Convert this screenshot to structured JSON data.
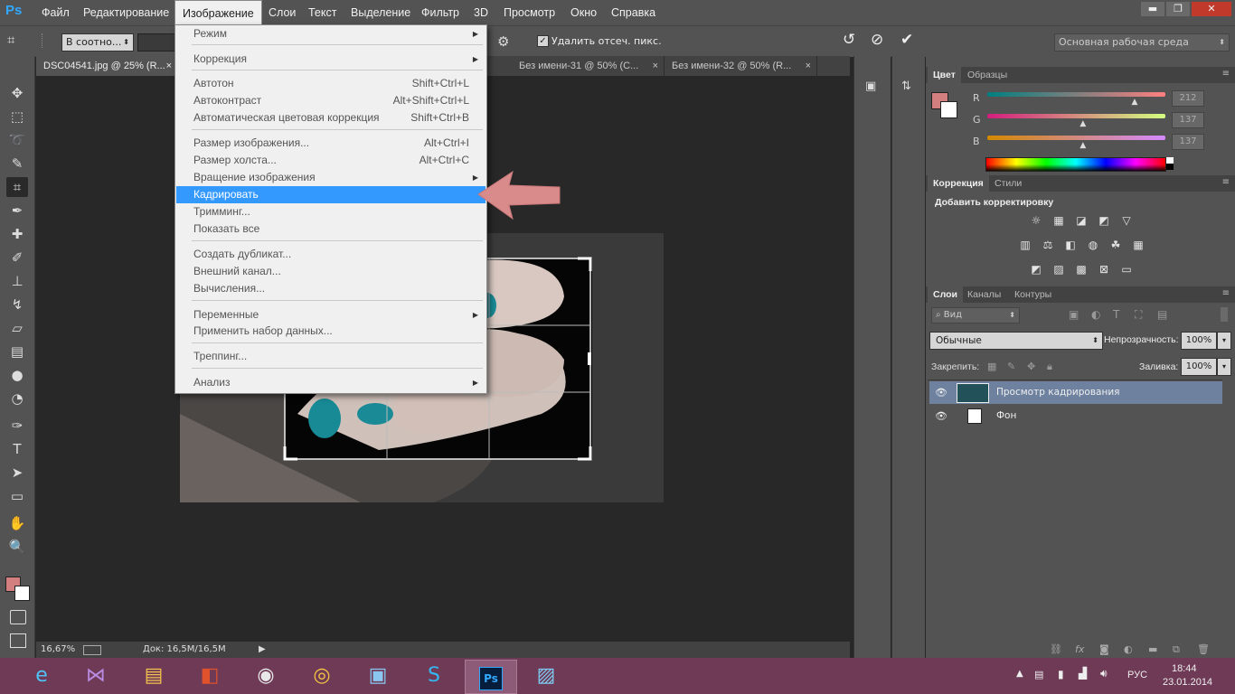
{
  "app": {
    "logo": "Ps"
  },
  "menubar": {
    "items": [
      "Файл",
      "Редактирование",
      "Изображение",
      "Слои",
      "Текст",
      "Выделение",
      "Фильтр",
      "3D",
      "Просмотр",
      "Окно",
      "Справка"
    ],
    "open_item": "Изображение"
  },
  "window_controls": {
    "minimize": "▬",
    "restore": "❐",
    "close": "✕"
  },
  "options_bar": {
    "ratio_select": "В соотно...",
    "delete_cropped_label": "Удалить отсеч. пикс.",
    "delete_cropped_checked": true,
    "workspace": "Основная рабочая среда"
  },
  "doc_tabs": [
    {
      "label": "DSC04541.jpg @ 25% (R...",
      "active": true,
      "close": "×"
    },
    {
      "label": "Без имени-31 @ 50% (C...",
      "active": false,
      "close": "×"
    },
    {
      "label": "Без имени-32 @ 50% (R...",
      "active": false,
      "close": "×"
    }
  ],
  "image_menu": {
    "items": [
      {
        "label": "Режим",
        "shortcut": "",
        "submenu": true
      },
      {
        "sep": true
      },
      {
        "label": "Коррекция",
        "shortcut": "",
        "submenu": true
      },
      {
        "sep": true
      },
      {
        "label": "Автотон",
        "shortcut": "Shift+Ctrl+L"
      },
      {
        "label": "Автоконтраст",
        "shortcut": "Alt+Shift+Ctrl+L"
      },
      {
        "label": "Автоматическая цветовая коррекция",
        "shortcut": "Shift+Ctrl+B"
      },
      {
        "sep": true
      },
      {
        "label": "Размер изображения...",
        "shortcut": "Alt+Ctrl+I"
      },
      {
        "label": "Размер холста...",
        "shortcut": "Alt+Ctrl+C"
      },
      {
        "label": "Вращение изображения",
        "shortcut": "",
        "submenu": true
      },
      {
        "label": "Кадрировать",
        "shortcut": "",
        "highlighted": true
      },
      {
        "label": "Тримминг...",
        "shortcut": ""
      },
      {
        "label": "Показать все",
        "shortcut": ""
      },
      {
        "sep": true
      },
      {
        "label": "Создать дубликат...",
        "shortcut": ""
      },
      {
        "label": "Внешний канал...",
        "shortcut": ""
      },
      {
        "label": "Вычисления...",
        "shortcut": ""
      },
      {
        "sep": true
      },
      {
        "label": "Переменные",
        "shortcut": "",
        "submenu": true
      },
      {
        "label": "Применить набор данных...",
        "shortcut": ""
      },
      {
        "sep": true
      },
      {
        "label": "Треппинг...",
        "shortcut": ""
      },
      {
        "sep": true
      },
      {
        "label": "Анализ",
        "shortcut": "",
        "submenu": true
      }
    ]
  },
  "status_bar": {
    "zoom": "16,67%",
    "doc_info": "Док: 16,5M/16,5M"
  },
  "color_panel": {
    "tabs": [
      "Цвет",
      "Образцы"
    ],
    "channels": [
      {
        "name": "R",
        "value": "212",
        "level": 0.83
      },
      {
        "name": "G",
        "value": "137",
        "level": 0.54
      },
      {
        "name": "B",
        "value": "137",
        "level": 0.54
      }
    ],
    "fg_color": "#d47f7f"
  },
  "adjust_panel": {
    "tabs": [
      "Коррекция",
      "Стили"
    ],
    "title": "Добавить корректировку"
  },
  "layers_panel": {
    "tabs": [
      "Слои",
      "Каналы",
      "Контуры"
    ],
    "search_label": "Вид",
    "blend_mode": "Обычные",
    "opacity_label": "Непрозрачность:",
    "opacity_value": "100%",
    "lock_label": "Закрепить:",
    "fill_label": "Заливка:",
    "fill_value": "100%",
    "layers": [
      {
        "name": "Просмотр кадрирования",
        "selected": true
      },
      {
        "name": "Фон",
        "selected": false
      }
    ]
  },
  "taskbar": {
    "lang": "РУС",
    "time": "18:44",
    "date": "23.01.2014",
    "apps": [
      "ie",
      "visual-studio",
      "explorer",
      "office",
      "paint",
      "chrome",
      "remote-desktop",
      "skype",
      "photoshop",
      "photo-viewer"
    ],
    "active_app": "photoshop"
  },
  "colors": {
    "accent": "#3399ff",
    "arrow": "#d98a8a",
    "taskbar": "#6e3a56"
  }
}
